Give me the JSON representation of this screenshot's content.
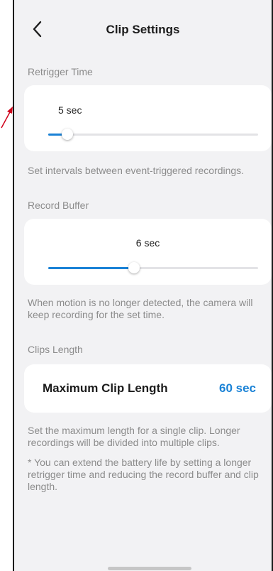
{
  "header": {
    "title": "Clip Settings",
    "back_icon": "chevron-left-icon"
  },
  "retrigger": {
    "section_label": "Retrigger Time",
    "value": "5 sec",
    "slider_fraction": 0.09,
    "description": "Set intervals between event-triggered recordings."
  },
  "record_buffer": {
    "section_label": "Record Buffer",
    "value": "6 sec",
    "slider_fraction": 0.41,
    "description": "When motion is no longer detected, the camera will keep recording for the set time."
  },
  "clips_length": {
    "section_label": "Clips Length",
    "row_label": "Maximum Clip Length",
    "row_value": "60 sec",
    "description": "Set the maximum length for a single clip. Longer recordings will be divided into multiple clips.",
    "note": "* You can extend the battery life by setting a longer retrigger time and reducing the record buffer and clip length."
  },
  "colors": {
    "accent": "#1a82d6",
    "background": "#f2f2f4",
    "annotation_arrow": "#d0021b"
  }
}
